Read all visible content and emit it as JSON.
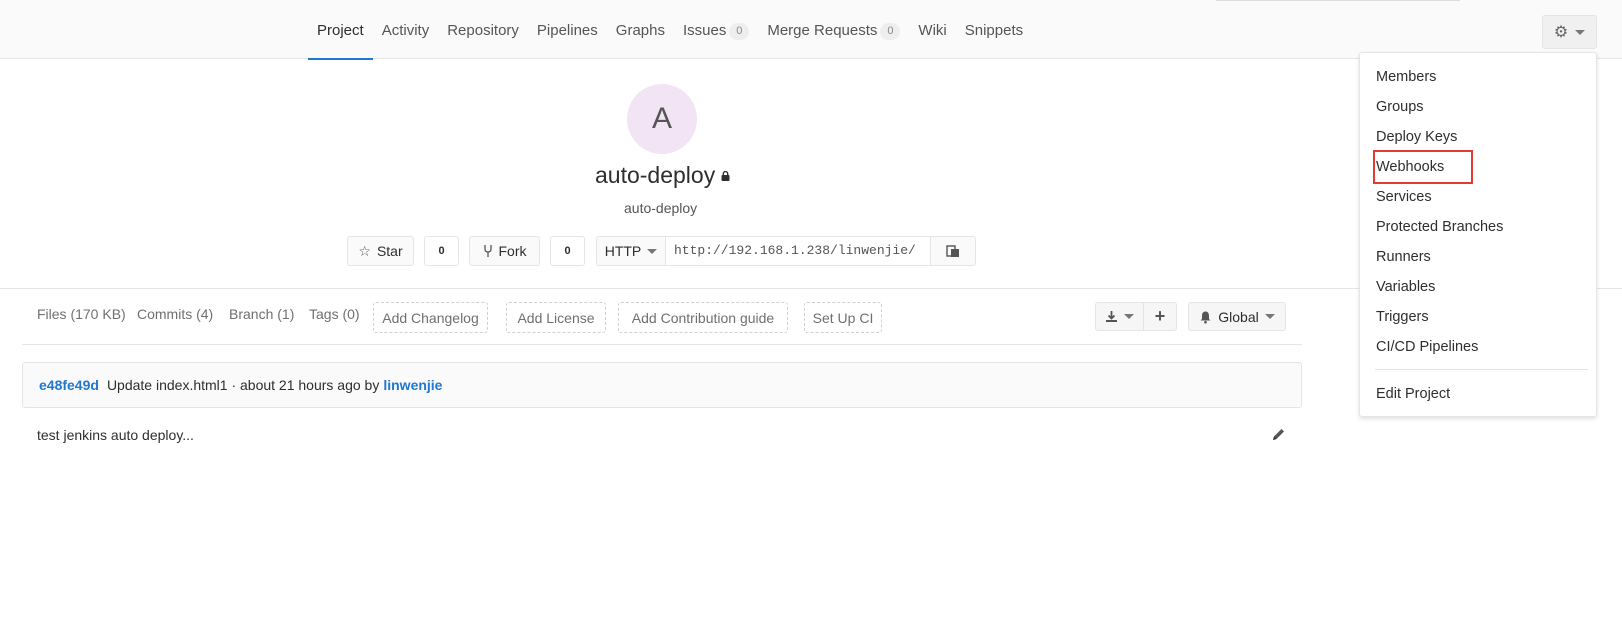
{
  "nav": {
    "tabs": [
      {
        "label": "Project",
        "active": true
      },
      {
        "label": "Activity"
      },
      {
        "label": "Repository"
      },
      {
        "label": "Pipelines"
      },
      {
        "label": "Graphs"
      },
      {
        "label": "Issues",
        "count": "0"
      },
      {
        "label": "Merge Requests",
        "count": "0"
      },
      {
        "label": "Wiki"
      },
      {
        "label": "Snippets"
      }
    ],
    "settings_icon": "gear-icon"
  },
  "settings_menu": {
    "items": [
      "Members",
      "Groups",
      "Deploy Keys",
      "Webhooks",
      "Services",
      "Protected Branches",
      "Runners",
      "Variables",
      "Triggers",
      "CI/CD Pipelines"
    ],
    "highlighted": "Webhooks",
    "footer_item": "Edit Project",
    "highlight_color": "#e53935"
  },
  "project": {
    "avatar_letter": "A",
    "avatar_color": "#f2e4f4",
    "name": "auto-deploy",
    "description": "auto-deploy",
    "visibility_icon": "lock-icon"
  },
  "actions": {
    "star_label": "Star",
    "star_count": "0",
    "fork_label": "Fork",
    "fork_count": "0",
    "protocol": "HTTP",
    "clone_url": "http://192.168.1.238/linwenjie/"
  },
  "stats": {
    "files": "Files (170 KB)",
    "commits": "Commits (4)",
    "branch": "Branch (1)",
    "tags": "Tags (0)"
  },
  "suggestions": [
    "Add Changelog",
    "Add License",
    "Add Contribution guide",
    "Set Up CI"
  ],
  "notifications": {
    "label": "Global"
  },
  "last_commit": {
    "sha": "e48fe49d",
    "message": "Update index.html1 · about 21 hours ago by",
    "author": "linwenjie"
  },
  "readme": {
    "text": "test jenkins auto deploy..."
  },
  "colors": {
    "link": "#1f78d1",
    "active_tab_border": "#1f78d1"
  }
}
